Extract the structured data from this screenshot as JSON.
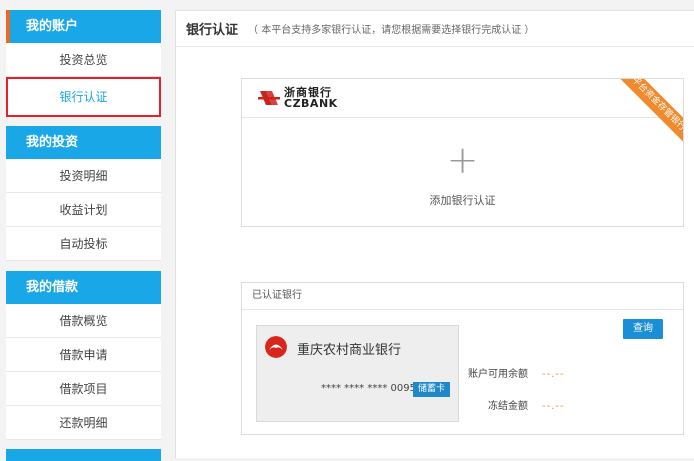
{
  "sidebar": {
    "sections": [
      {
        "title": "我的账户",
        "items": [
          "投资总览",
          "银行认证"
        ]
      },
      {
        "title": "我的投资",
        "items": [
          "投资明细",
          "收益计划",
          "自动投标"
        ]
      },
      {
        "title": "我的借款",
        "items": [
          "借款概览",
          "借款申请",
          "借款项目",
          "还款明细"
        ]
      }
    ],
    "selected_item": "银行认证"
  },
  "main": {
    "title": "银行认证",
    "subtitle": "（ 本平台支持多家银行认证，请您根据需要选择银行完成认证 ）",
    "add_card": {
      "bank_name_cn": "浙商银行",
      "bank_name_en": "CZBANK",
      "ribbon": "平台资金存管银行",
      "plus": "+",
      "label": "添加银行认证"
    },
    "verified": {
      "header": "已认证银行",
      "bank_name": "重庆农村商业银行",
      "card_number": "**** **** **** 0095",
      "card_type": "储蓄卡",
      "query_button": "查询",
      "available_label": "账户可用余额",
      "available_value": "--.--",
      "frozen_label": "冻结金额",
      "frozen_value": "--.--"
    }
  },
  "colors": {
    "accent": "#1aa7e8",
    "ribbon": "#f08a2c",
    "selected_border": "#e4212b",
    "card_type_badge": "#1e88c9",
    "cq_logo": "#d9261c"
  },
  "icons": {
    "cz_bank_logo": "czbank-logo-icon",
    "cq_bank_logo": "cq-bank-logo-icon",
    "add": "plus-icon"
  }
}
